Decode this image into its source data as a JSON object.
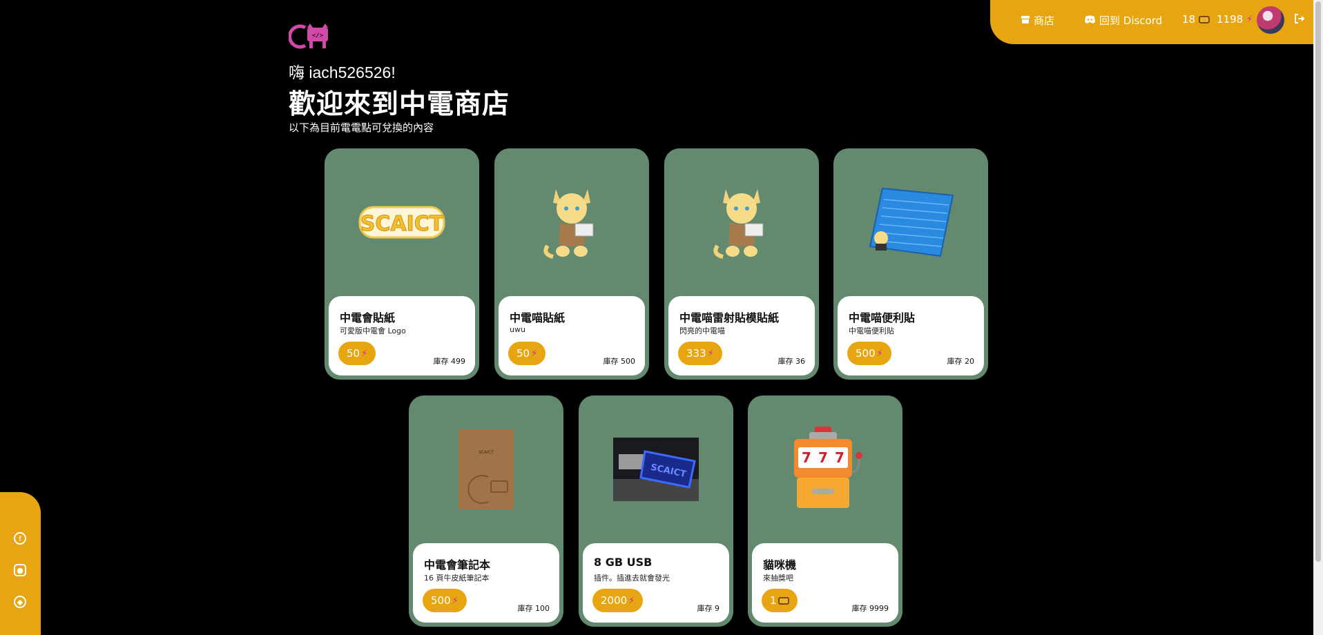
{
  "nav": {
    "shop_label": "商店",
    "discord_label": "回到 Discord",
    "tickets": "18",
    "points": "1198"
  },
  "header": {
    "greeting": "嗨 iach526526!",
    "title": "歡迎來到中電商店",
    "subtitle": "以下為目前電電點可兌換的內容"
  },
  "stock_label": "庫存",
  "products": [
    {
      "name": "中電會貼紙",
      "desc": "可愛版中電會 Logo",
      "price": "50",
      "currency": "points",
      "stock": "499",
      "image": "scaict-logo-sticker"
    },
    {
      "name": "中電喵貼紙",
      "desc": "uwu",
      "price": "50",
      "currency": "points",
      "stock": "500",
      "image": "scaict-cat-sticker"
    },
    {
      "name": "中電喵雷射貼模貼紙",
      "desc": "閃亮的中電喵",
      "price": "333",
      "currency": "points",
      "stock": "36",
      "image": "scaict-cat-laser-sticker"
    },
    {
      "name": "中電喵便利貼",
      "desc": "中電喵便利貼",
      "price": "500",
      "currency": "points",
      "stock": "20",
      "image": "sticky-notes"
    },
    {
      "name": "中電會筆記本",
      "desc": "16 頁牛皮紙筆記本",
      "price": "500",
      "currency": "points",
      "stock": "100",
      "image": "kraft-notebook"
    },
    {
      "name": "8 GB USB",
      "desc": "插件。插進去就會發光",
      "price": "2000",
      "currency": "points",
      "stock": "9",
      "image": "glowing-usb"
    },
    {
      "name": "貓咪機",
      "desc": "來抽獎吧",
      "price": "1",
      "currency": "tickets",
      "stock": "9999",
      "image": "slot-machine"
    }
  ],
  "images": {
    "logo_sticker_text": "SCAICT",
    "notebook_brand": "SCAICT",
    "slot_symbols": [
      "7",
      "7",
      "7"
    ]
  },
  "colors": {
    "accent": "#e8a512",
    "card_bg": "#638a6f",
    "bolt": "#d12a9a",
    "logo": "#d14aa8"
  }
}
